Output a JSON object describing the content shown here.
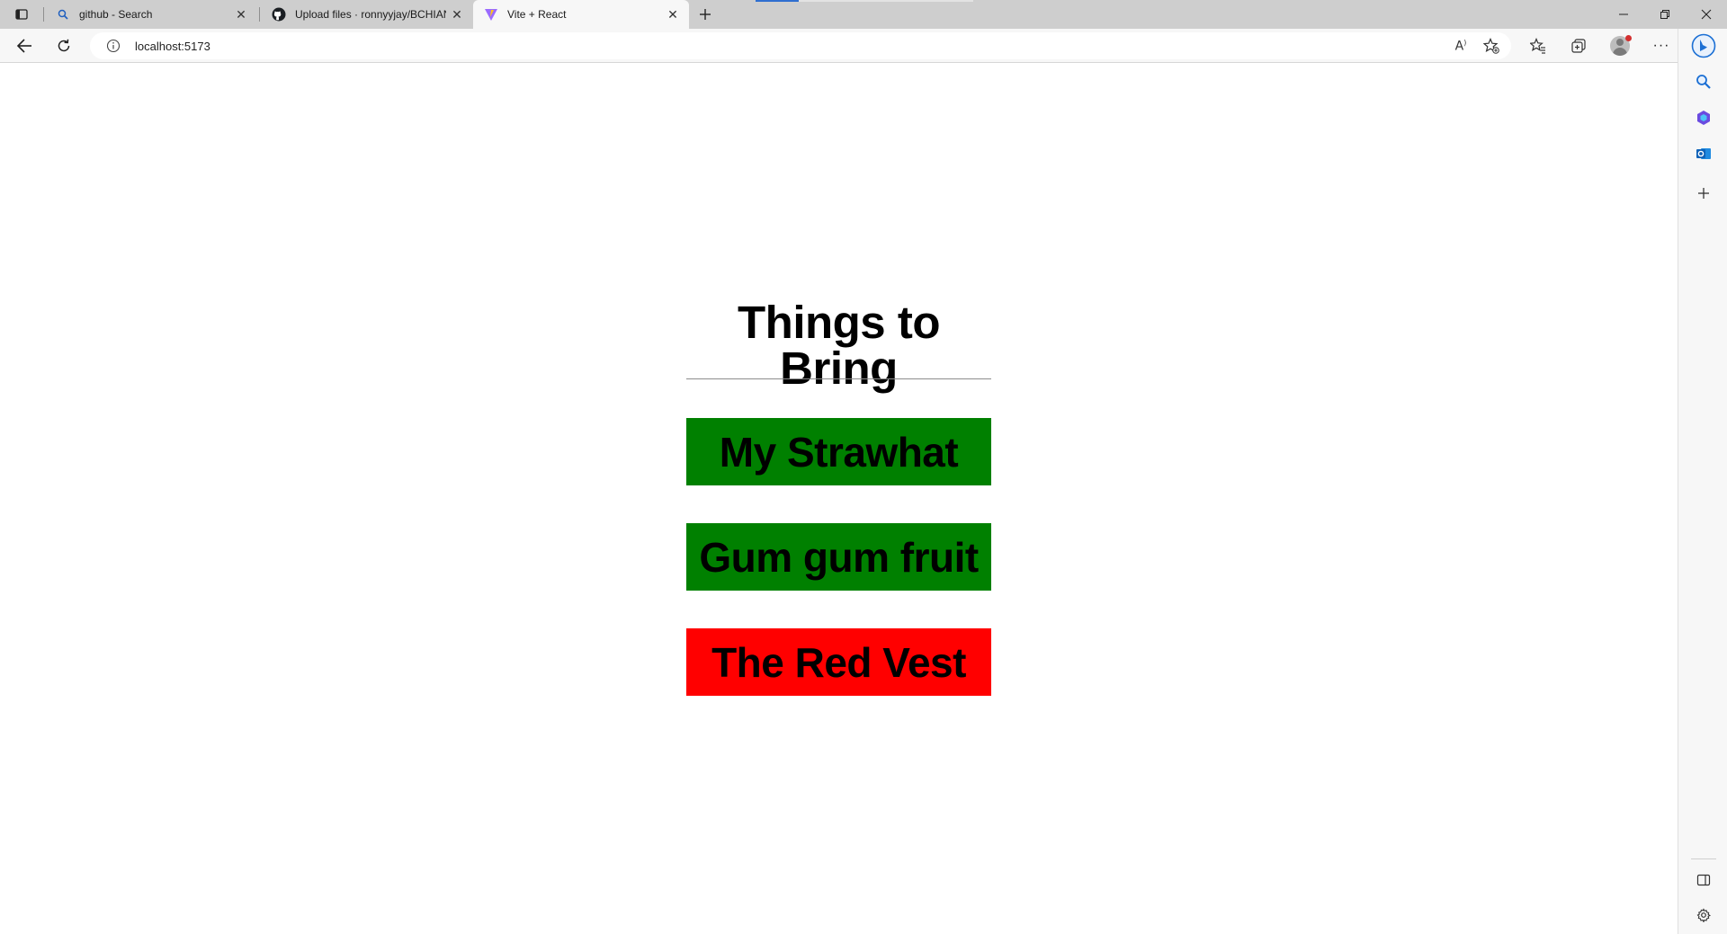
{
  "tabs": [
    {
      "title": "github - Search",
      "icon": "search-icon"
    },
    {
      "title": "Upload files · ronnyyjay/BCHIAN",
      "icon": "github-icon"
    },
    {
      "title": "Vite + React",
      "icon": "vite-icon"
    }
  ],
  "address_bar": {
    "url": "localhost:5173"
  },
  "page": {
    "heading": "Things to Bring",
    "items": [
      {
        "label": "My Strawhat",
        "color": "#008000"
      },
      {
        "label": "Gum gum fruit",
        "color": "#008000"
      },
      {
        "label": "The Red Vest",
        "color": "#ff0000"
      }
    ]
  },
  "colors": {
    "packed": "#008000",
    "not_packed": "#ff0000"
  }
}
